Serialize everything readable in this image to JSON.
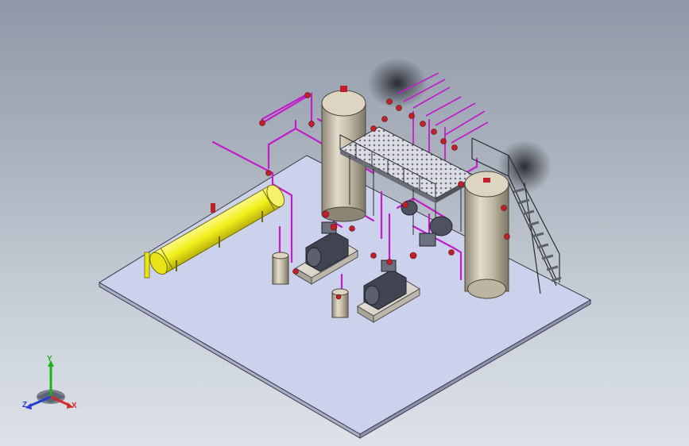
{
  "view": {
    "background_top": "#8f98a6",
    "background_bottom": "#dde2e8",
    "floor_color": "#cdd2ec",
    "pipe_color": "#c01fc8",
    "vessel_color": "#f2ef1a",
    "tank_color": "#c2b8a6",
    "valve_color": "#c0202a"
  },
  "triad": {
    "y_label": "Y",
    "z_label": "Z",
    "x_label": "X",
    "y_color": "#1fae1f",
    "z_color": "#2a3fd0",
    "x_color": "#d22b2b"
  },
  "model": {
    "components": [
      "floor-slab",
      "horizontal-vessel",
      "vertical-tank-left",
      "vertical-tank-right",
      "pump-skid-left",
      "pump-skid-right",
      "platform-grating",
      "staircase",
      "piping",
      "valves"
    ]
  }
}
